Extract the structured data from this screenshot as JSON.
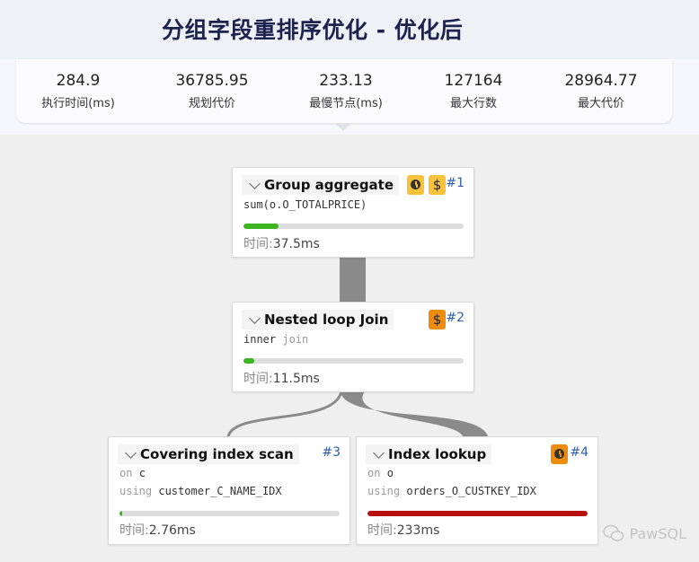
{
  "title": "分组字段重排序优化 - 优化后",
  "stats": [
    {
      "value": "284.9",
      "label": "执行时间(ms)"
    },
    {
      "value": "36785.95",
      "label": "规划代价"
    },
    {
      "value": "233.13",
      "label": "最慢节点(ms)"
    },
    {
      "value": "127164",
      "label": "最大行数"
    },
    {
      "value": "28964.77",
      "label": "最大代价"
    }
  ],
  "nodes": {
    "n1": {
      "name": "Group aggregate",
      "index": "#1",
      "detail": "sum(o.O_TOTALPRICE)",
      "time_label": "时间:",
      "time": "37.5ms",
      "bar_fraction": 0.16,
      "bar_color": "#3cb521"
    },
    "n2": {
      "name": "Nested loop Join",
      "index": "#2",
      "detail_kw": "inner",
      "detail_rest": "join",
      "time_label": "时间:",
      "time": "11.5ms",
      "bar_fraction": 0.05,
      "bar_color": "#3cb521"
    },
    "n3": {
      "name": "Covering index scan",
      "index": "#3",
      "on_kw": "on",
      "on_val": "c",
      "using_kw": "using",
      "using_val": "customer_C_NAME_IDX",
      "time_label": "时间:",
      "time": "2.76ms",
      "bar_fraction": 0.012,
      "bar_color": "#3cb521"
    },
    "n4": {
      "name": "Index lookup",
      "index": "#4",
      "on_kw": "on",
      "on_val": "o",
      "using_kw": "using",
      "using_val": "orders_O_CUSTKEY_IDX",
      "time_label": "时间:",
      "time": "233ms",
      "bar_fraction": 1.0,
      "bar_color": "#b7110f"
    }
  },
  "badges": {
    "time_icon": "clock-icon",
    "cost_icon": "dollar-icon",
    "dollar": "$"
  },
  "watermark": "PawSQL",
  "colors": {
    "title": "#1d2350",
    "link": "#8a8a8a",
    "index": "#2d5da8",
    "badge_time": "#f8c33a",
    "badge_cost_warn": "#ee8c10"
  }
}
